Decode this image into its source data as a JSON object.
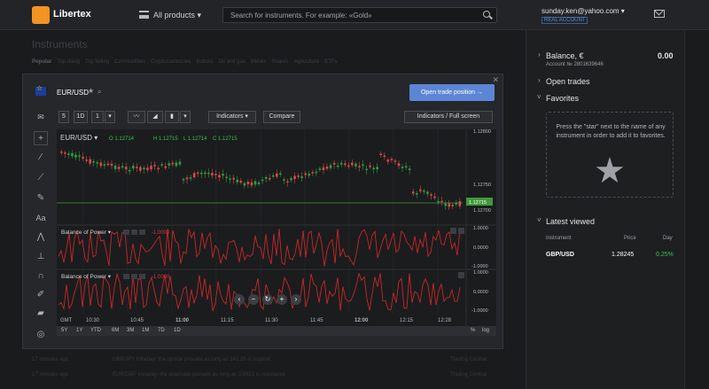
{
  "header": {
    "brand": "Libertex",
    "all_products": "All products ▾",
    "search_placeholder": "Search for instruments. For example: «Gold»",
    "user_email": "sunday.ken@yahoo.com ▾",
    "account_type": "REAL ACCOUNT"
  },
  "background": {
    "instruments_title": "Instruments",
    "tabs": [
      "Popular",
      "Top rising",
      "Top falling",
      "Commodities",
      "Cryptocurrencies",
      "Indices",
      "Oil and gas",
      "Metals",
      "Shares",
      "Agriculture",
      "ETFs"
    ],
    "news": [
      {
        "time": "17 minutes ago",
        "headline": "GBP/JPY intraday: the upside prevails as long as 141.25 is support",
        "source": "Trading Central"
      },
      {
        "time": "17 minutes ago",
        "headline": "EUR/GBP intraday: the downside prevails as long as 0.8813 is resistance",
        "source": "Trading Central"
      }
    ]
  },
  "sidebar": {
    "balance_label": "Balance, €",
    "balance_value": "0.00",
    "account_number": "Account № 2801639646",
    "open_trades": "Open trades",
    "favorites": "Favorites",
    "favorites_hint": "Press the \"star\" next to the name of any instrument in order to add it to favorites.",
    "latest_viewed": "Latest viewed",
    "columns": {
      "instrument": "Instrument",
      "price": "Price",
      "day": "Day"
    },
    "latest_rows": [
      {
        "instrument": "GBP/USD",
        "price": "1.28245",
        "day": "0.25%"
      }
    ],
    "positive_color": "#3cc24a"
  },
  "modal": {
    "pair": "EUR/USD",
    "open_trade": "Open trade position →",
    "toolbar": {
      "timeframes": [
        "5",
        "1D",
        "1"
      ],
      "indicators": "Indicators ▾",
      "compare": "Compare",
      "fullscreen": "Indicators / Full screen"
    },
    "side_tools": [
      "crosshair-icon",
      "line-icon",
      "fib-icon",
      "brush-icon",
      "text-icon",
      "pattern-icon",
      "measure-icon",
      "magnet-icon",
      "lock-icon",
      "eye-icon"
    ],
    "ohlc": {
      "symbol": "EUR/USD ▾",
      "o": "O 1.12714",
      "h": "H 1.12715",
      "l": "L 1.12714",
      "c": "C 1.12715"
    },
    "price_labels": [
      "1.12800",
      "1.12750",
      "1.12715",
      "1.12700"
    ],
    "indicator_panels": [
      {
        "name": "Balance of Power ▾",
        "value": "-1.0000",
        "axis": [
          "1.0000",
          "0.0000",
          "-1.0000"
        ]
      },
      {
        "name": "Balance of Power ▾",
        "value": "-1.0000",
        "axis": [
          "1.0000",
          "0.0000",
          "-1.0000"
        ]
      }
    ],
    "time_labels": [
      "GMT",
      "10:30",
      "10:45",
      "11:00",
      "11:15",
      "11:30",
      "11:45",
      "12:00",
      "12:15",
      "12:28"
    ],
    "ranges": [
      "5Y",
      "1Y",
      "YTD",
      "6M",
      "3M",
      "1M",
      "7D",
      "1D"
    ],
    "scale_opts": [
      "%",
      "log"
    ]
  }
}
